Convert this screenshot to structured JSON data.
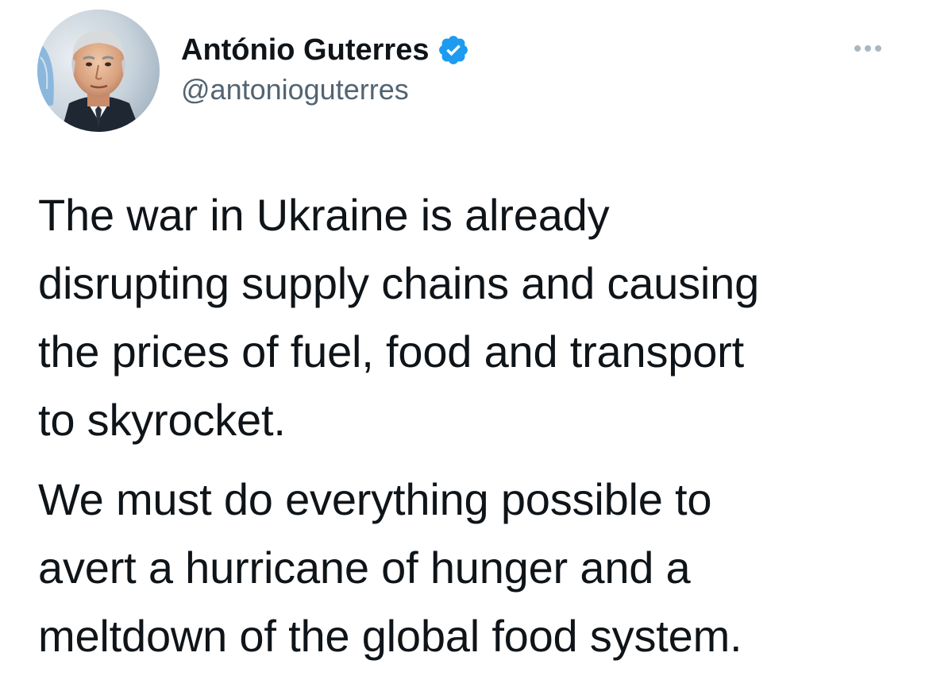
{
  "author": {
    "display_name": "António Guterres",
    "handle": "@antonioguterres",
    "avatar_icon": "profile-photo",
    "verified_icon": "verified-badge-icon",
    "verified_color": "#1d9bf0"
  },
  "actions": {
    "more_icon": "more-options-icon"
  },
  "tweet": {
    "lines_p1": [
      "The war in Ukraine is already",
      "disrupting supply chains and causing",
      "the prices of fuel, food and transport",
      "to skyrocket."
    ],
    "lines_p2": [
      "We must do everything possible to",
      "avert a hurricane of hunger and a",
      "meltdown of the global food system."
    ]
  },
  "colors": {
    "text": "#0f1419",
    "secondary": "#536471",
    "more_dots": "#aab8c2"
  }
}
